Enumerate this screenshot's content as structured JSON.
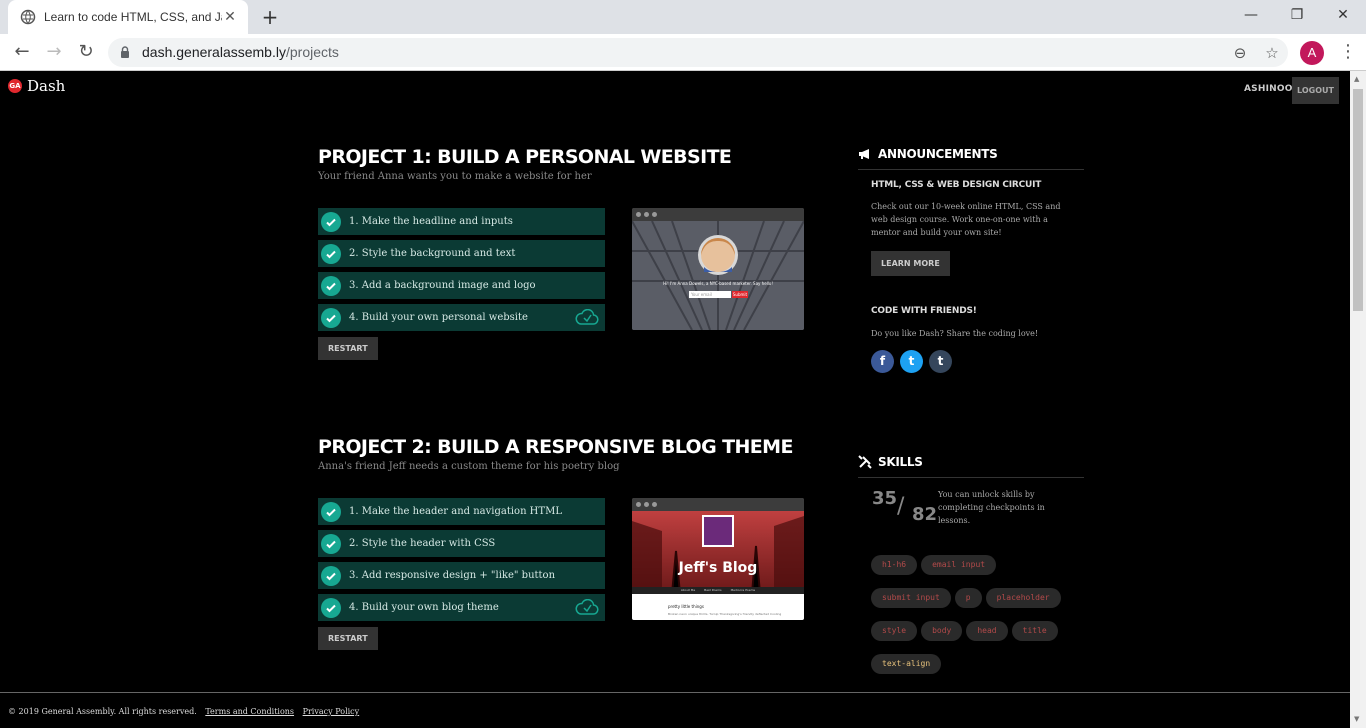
{
  "browser": {
    "tab_title": "Learn to code HTML, CSS, and Ja",
    "url_host": "dash.generalassemb.ly",
    "url_path": "/projects",
    "profile_initial": "A"
  },
  "header": {
    "logo_badge": "GA",
    "logo_text": "Dash",
    "username": "ASHINOOO",
    "logout_label": "LOGOUT"
  },
  "projects": [
    {
      "title": "PROJECT 1: BUILD A PERSONAL WEBSITE",
      "subtitle": "Your friend Anna wants you to make a website for her",
      "steps": [
        "1. Make the headline and inputs",
        "2. Style the background and text",
        "3. Add a background image and logo",
        "4. Build your own personal website"
      ],
      "restart_label": "RESTART",
      "thumb_caption": "Hi! I'm Anna Dowels, a NYC-based marketer. Say hello!",
      "thumb_input_placeholder": "Your email",
      "thumb_button": "Submit"
    },
    {
      "title": "PROJECT 2: BUILD A RESPONSIVE BLOG THEME",
      "subtitle": "Anna's friend Jeff needs a custom theme for his poetry blog",
      "steps": [
        "1. Make the header and navigation HTML",
        "2. Style the header with CSS",
        "3. Add responsive design + \"like\" button",
        "4. Build your own blog theme"
      ],
      "restart_label": "RESTART",
      "thumb_blog_title": "Jeff's Blog",
      "thumb_nav": [
        "About Me",
        "Best Poems",
        "Mediocre Poems"
      ],
      "thumb_post_title": "pretty little things",
      "thumb_post_text": "Broken neon unique thrills. Turnip Thanksgiving's friendly deflected Cooling"
    }
  ],
  "announcements": {
    "heading": "ANNOUNCEMENTS",
    "item1_title": "HTML, CSS & WEB DESIGN CIRCUIT",
    "item1_text": "Check out our 10-week online HTML, CSS and web design course. Work one-on-one with a mentor and build your own site!",
    "learn_more_label": "LEARN MORE",
    "item2_title": "CODE WITH FRIENDS!",
    "item2_text": "Do you like Dash? Share the coding love!",
    "social": [
      "f",
      "t",
      "t"
    ]
  },
  "skills": {
    "heading": "SKILLS",
    "unlocked": "35",
    "slash": "/",
    "total": "82",
    "note": "You can unlock skills by completing checkpoints in lessons.",
    "chips": [
      "h1-h6",
      "email input",
      "submit input",
      "p",
      "placeholder",
      "style",
      "body",
      "head",
      "title",
      "text-align"
    ]
  },
  "footer": {
    "copyright": "© 2019 General Assembly. All rights reserved.",
    "terms": "Terms and Conditions",
    "privacy": "Privacy Policy"
  },
  "colors": {
    "accent_teal": "#17a892",
    "step_bg": "#0b3a34",
    "brand_red": "#e0282e",
    "facebook": "#3b5998",
    "twitter": "#1da1f2",
    "tumblr": "#35465c"
  }
}
